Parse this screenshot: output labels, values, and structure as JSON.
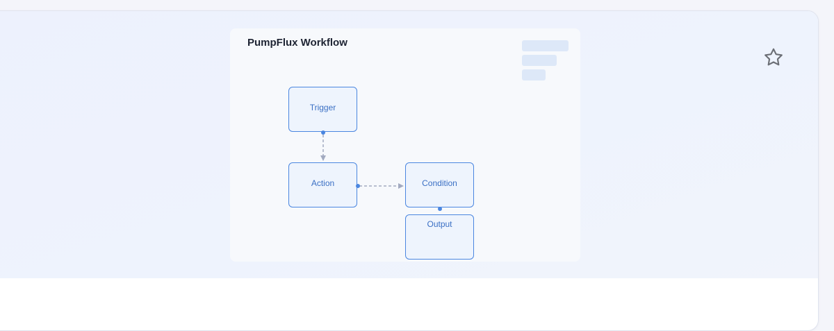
{
  "page": {
    "star_icon": "star-outline-icon"
  },
  "preview": {
    "title": "PumpFlux Workflow",
    "nodes": {
      "trigger": "Trigger",
      "action": "Action",
      "condition": "Condition",
      "output": "Output"
    }
  },
  "colors": {
    "node_border": "#4a86e0",
    "node_fill": "#eef4fd",
    "node_text": "#3a6fc4",
    "edge": "#a2aac0",
    "placeholder": "#dde8f8",
    "hero_bg": "#edf1fd"
  }
}
